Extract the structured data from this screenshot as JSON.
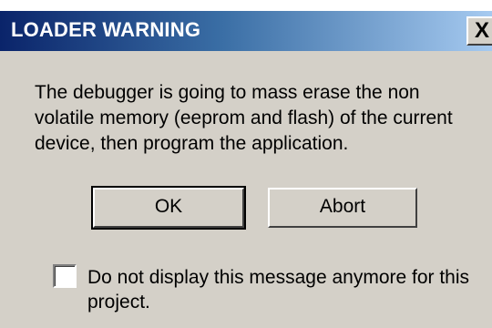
{
  "window": {
    "title": "LOADER WARNING",
    "close_label": "X"
  },
  "message": "The debugger is going to mass erase the non volatile memory (eeprom and flash) of the current device, then program the application.",
  "buttons": {
    "ok_label": "OK",
    "abort_label": "Abort"
  },
  "checkbox": {
    "label": "Do not display this message anymore for this project.",
    "checked": false
  },
  "colors": {
    "dialog_face": "#d4d0c8",
    "title_gradient_start": "#0a246a",
    "title_gradient_end": "#a6caf0",
    "title_text": "#ffffff"
  }
}
